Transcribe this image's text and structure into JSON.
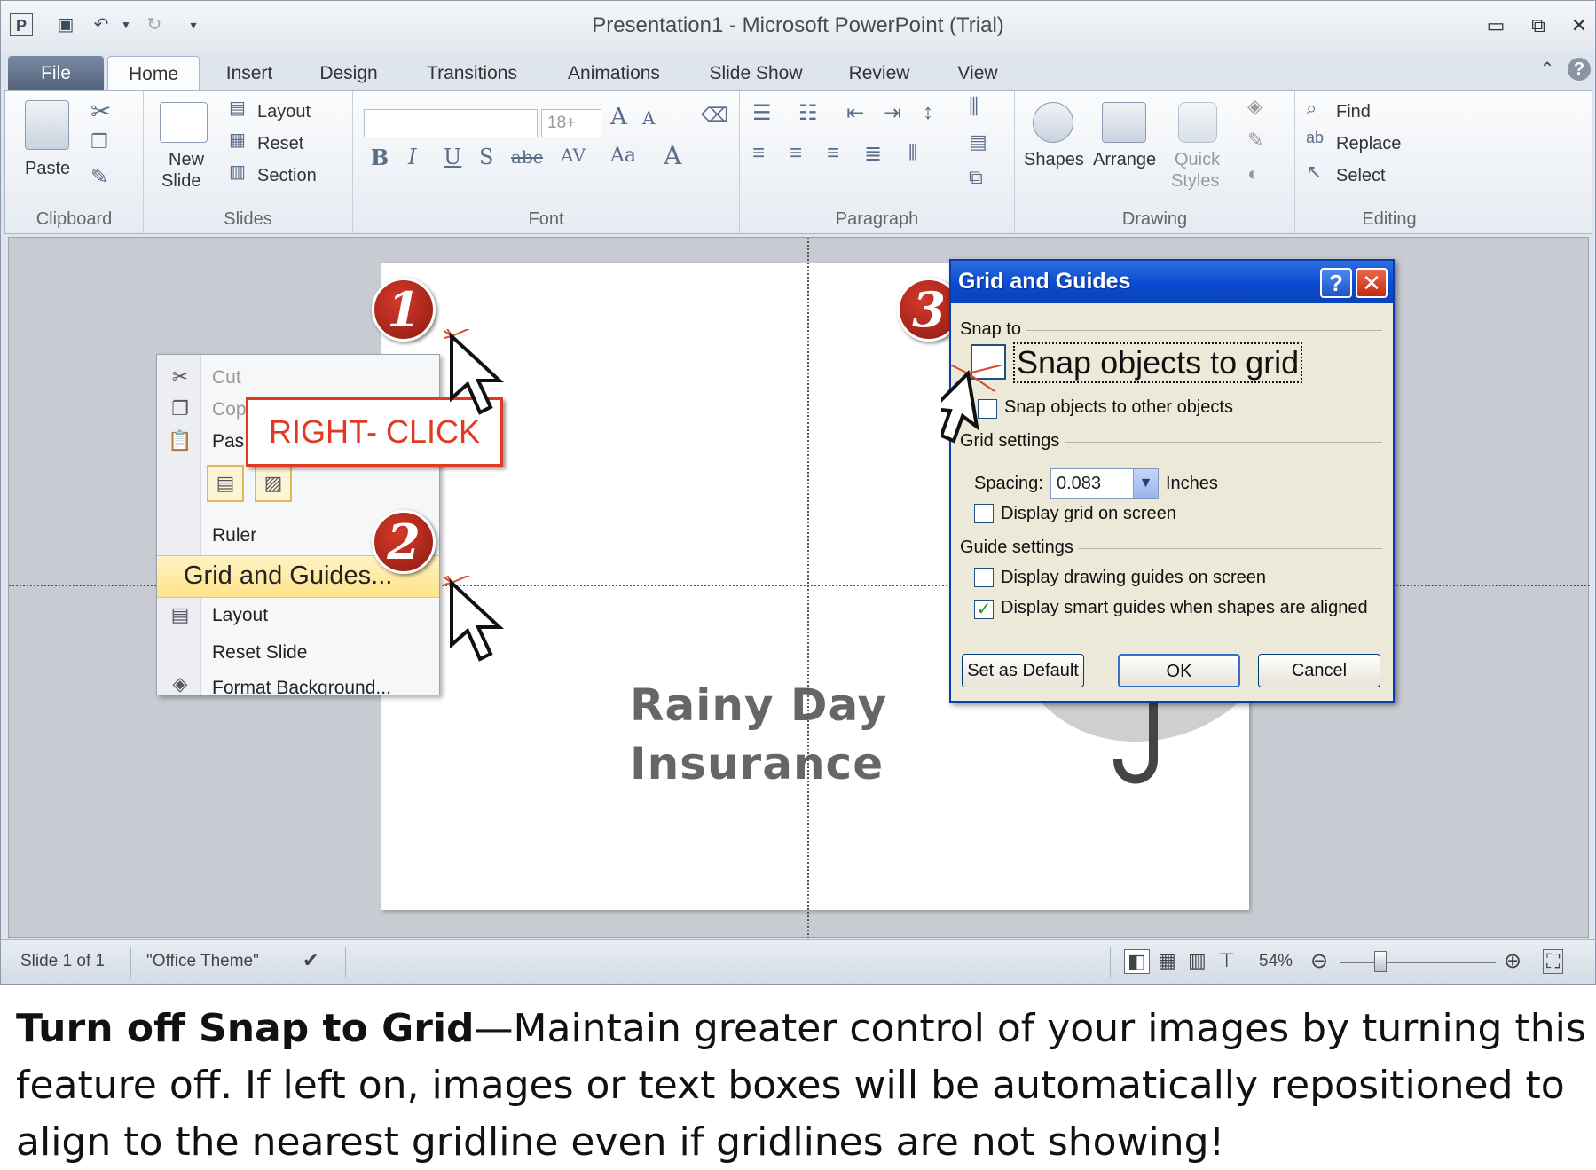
{
  "titlebar": {
    "title": "Presentation1  -  Microsoft PowerPoint (Trial)"
  },
  "tabs": [
    "File",
    "Home",
    "Insert",
    "Design",
    "Transitions",
    "Animations",
    "Slide Show",
    "Review",
    "View"
  ],
  "ribbon": {
    "clipboard": {
      "label": "Clipboard",
      "paste": "Paste"
    },
    "slides": {
      "label": "Slides",
      "new_slide_1": "New",
      "new_slide_2": "Slide",
      "layout": "Layout",
      "reset": "Reset",
      "section": "Section"
    },
    "font": {
      "label": "Font",
      "size": "18+"
    },
    "paragraph": {
      "label": "Paragraph"
    },
    "drawing": {
      "label": "Drawing",
      "shapes": "Shapes",
      "arrange": "Arrange",
      "quick_1": "Quick",
      "quick_2": "Styles"
    },
    "editing": {
      "label": "Editing",
      "find": "Find",
      "replace": "Replace",
      "select": "Select"
    }
  },
  "slide": {
    "logo_line1": "Rainy Day",
    "logo_line2": "Insurance"
  },
  "context_menu": {
    "cut": "Cut",
    "copy": "Cop",
    "paste": "Pas",
    "ruler": "Ruler",
    "grid_and_guides": "Grid and Guides...",
    "layout": "Layout",
    "reset_slide": "Reset Slide",
    "format_background": "Format Background..."
  },
  "annotations": {
    "right_click": "RIGHT- CLICK",
    "step1": "1",
    "step2": "2",
    "step3": "3"
  },
  "dialog": {
    "title": "Grid and Guides",
    "help": "?",
    "close": "✕",
    "snap_to": "Snap to",
    "snap_grid": "Snap objects to grid",
    "snap_other": "Snap objects to other objects",
    "grid_settings": "Grid settings",
    "spacing_label": "Spacing:",
    "spacing_value": "0.083",
    "spacing_unit": "Inches",
    "display_grid": "Display grid on screen",
    "guide_settings": "Guide settings",
    "display_guides": "Display drawing guides on screen",
    "smart_guides": "Display smart guides when shapes are aligned",
    "smart_guides_checked": true,
    "btn_default": "Set as Default",
    "btn_ok": "OK",
    "btn_cancel": "Cancel"
  },
  "statusbar": {
    "slide_info": "Slide 1 of 1",
    "theme": "\"Office Theme\"",
    "zoom": "54%"
  },
  "caption": {
    "bold": "Turn off Snap to Grid",
    "text": "—Maintain greater control of your images by turning this feature off.  If left on, images or text boxes will be automatically repositioned to align to the nearest gridline even if gridlines are not showing!"
  },
  "icons": {
    "app": "powerpoint-icon",
    "save": "save-icon",
    "undo": "undo-icon",
    "redo": "redo-icon",
    "cut": "scissors-icon",
    "copy": "copy-icon",
    "paste": "clipboard-icon",
    "check": "checkmark-icon"
  },
  "colors": {
    "accent_red": "#e03a22",
    "dialog_blue": "#0a4ad0",
    "menu_highlight": "#ffe38a"
  }
}
